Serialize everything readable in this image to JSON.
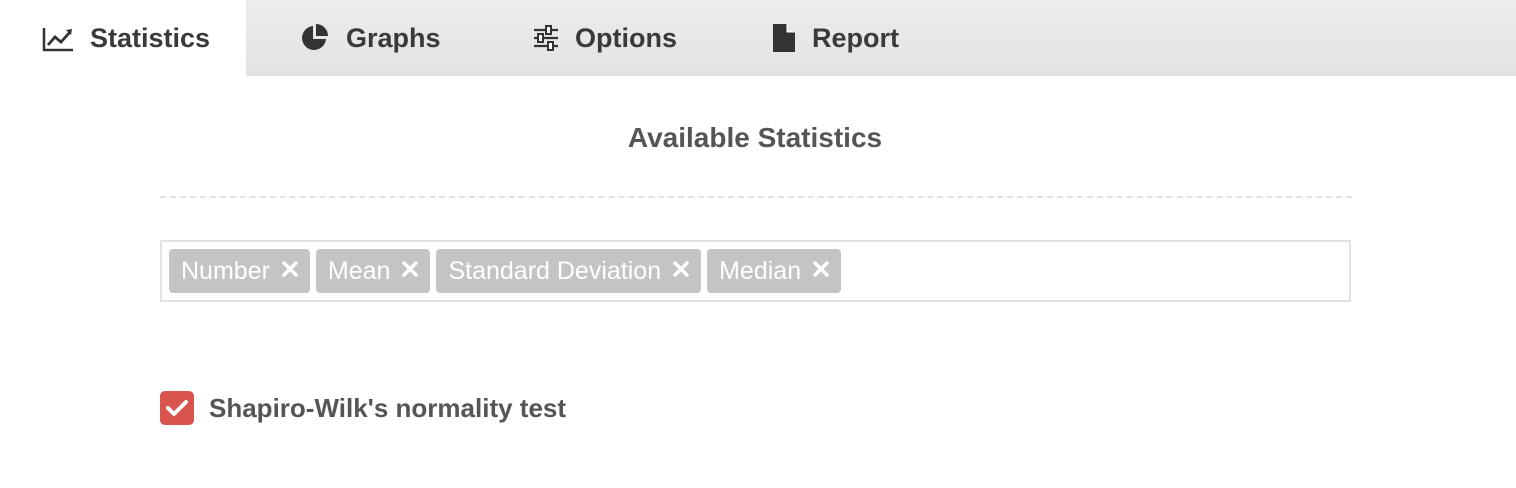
{
  "tabs": [
    {
      "label": "Statistics",
      "icon": "line-chart-icon",
      "active": true
    },
    {
      "label": "Graphs",
      "icon": "pie-chart-icon",
      "active": false
    },
    {
      "label": "Options",
      "icon": "sliders-icon",
      "active": false
    },
    {
      "label": "Report",
      "icon": "file-icon",
      "active": false
    }
  ],
  "main": {
    "title": "Available Statistics",
    "tags": [
      {
        "label": "Number"
      },
      {
        "label": "Mean"
      },
      {
        "label": "Standard Deviation"
      },
      {
        "label": "Median"
      }
    ],
    "normality_test": {
      "label": "Shapiro-Wilk's normality test",
      "checked": true
    }
  },
  "colors": {
    "checkbox": "#d9534f",
    "tag_bg": "#c4c4c4",
    "tabbar_bg": "#e6e6e6"
  }
}
